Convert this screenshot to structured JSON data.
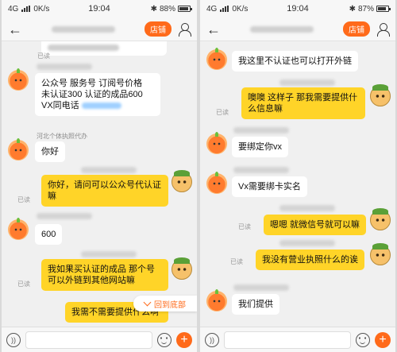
{
  "status_left": {
    "network": "4G",
    "speed": "0K/s"
  },
  "time": "19:04",
  "status_right": {
    "network": "4G"
  },
  "battery_left": {
    "percent": "88%",
    "level": 0.88
  },
  "battery_right": {
    "percent": "87%",
    "level": 0.87
  },
  "nav": {
    "back": "←",
    "shop": "店铺"
  },
  "read": "已读",
  "left_chat": {
    "shop_msg_1": {
      "lines": [
        "公众号 服务号 订阅号价格",
        "未认证300  认证的成品600",
        " VX同电话"
      ]
    },
    "sender_name": "河北个体执照代办",
    "shop_msg_2": "你好",
    "user_msg_1": "你好，请问可以公众号代认证嘛",
    "shop_msg_3": "600",
    "user_msg_2": "我如果买认证的成品 那个号可以外链到其他网站嘛",
    "user_msg_3": "我需不需要提供什么啊",
    "back_to_bottom": "回到底部"
  },
  "right_chat": {
    "shop_msg_1": "我这里不认证也可以打开外链",
    "user_msg_1": "噢噢 这样子 那我需要提供什么信息嘛",
    "shop_msg_2": "要绑定你vx",
    "shop_msg_3": "Vx需要绑卡实名",
    "user_msg_2": "嗯嗯 就微信号就可以嘛",
    "user_msg_3": "我没有营业执照什么的诶",
    "shop_msg_4": "我们提供"
  },
  "input": {
    "voice": "))"
  },
  "colors": {
    "accent": "#ff6a1a",
    "user_bubble": "#ffd428",
    "shop_bubble": "#ffffff",
    "background": "#f0f0f0"
  }
}
